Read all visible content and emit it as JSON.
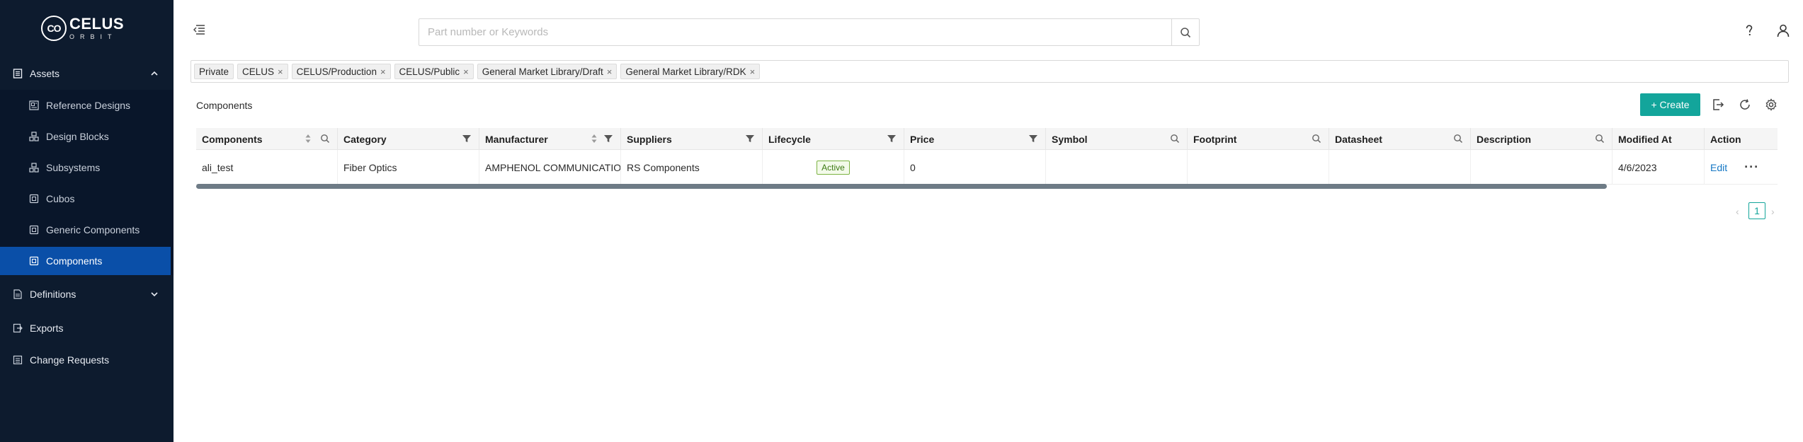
{
  "brand": {
    "name": "CELUS",
    "sub": "ORBIT",
    "mark": "CO"
  },
  "sidebar": {
    "assets_label": "Assets",
    "items": [
      {
        "label": "Reference Designs",
        "icon": "reference-designs-icon"
      },
      {
        "label": "Design Blocks",
        "icon": "design-blocks-icon"
      },
      {
        "label": "Subsystems",
        "icon": "subsystems-icon"
      },
      {
        "label": "Cubos",
        "icon": "cubos-icon"
      },
      {
        "label": "Generic Components",
        "icon": "generic-components-icon"
      },
      {
        "label": "Components",
        "icon": "components-icon",
        "active": true
      }
    ],
    "definitions_label": "Definitions",
    "exports_label": "Exports",
    "change_requests_label": "Change Requests"
  },
  "search": {
    "placeholder": "Part number or Keywords",
    "value": ""
  },
  "tags": [
    "Private",
    "CELUS",
    "CELUS/Production",
    "CELUS/Public",
    "General Market Library/Draft",
    "General Market Library/RDK"
  ],
  "main": {
    "title": "Components",
    "create_label": "+ Create"
  },
  "table": {
    "columns": [
      "Components",
      "Category",
      "Manufacturer",
      "Suppliers",
      "Lifecycle",
      "Price",
      "Symbol",
      "Footprint",
      "Datasheet",
      "Description",
      "Modified At",
      "Action"
    ],
    "rows": [
      {
        "component": "ali_test",
        "category": "Fiber Optics",
        "manufacturer": "AMPHENOL COMMUNICATION",
        "suppliers": "RS Components",
        "lifecycle": "Active",
        "price": "0",
        "symbol": "",
        "footprint": "",
        "datasheet": "",
        "description": "",
        "modified_at": "4/6/2023",
        "action_edit": "Edit",
        "action_more": "···"
      }
    ]
  },
  "pagination": {
    "current": "1",
    "prev": "‹",
    "next": "›"
  },
  "colors": {
    "sidebar_bg": "#0d1b2e",
    "active_item": "#0a4fa8",
    "accent": "#13a59b"
  }
}
